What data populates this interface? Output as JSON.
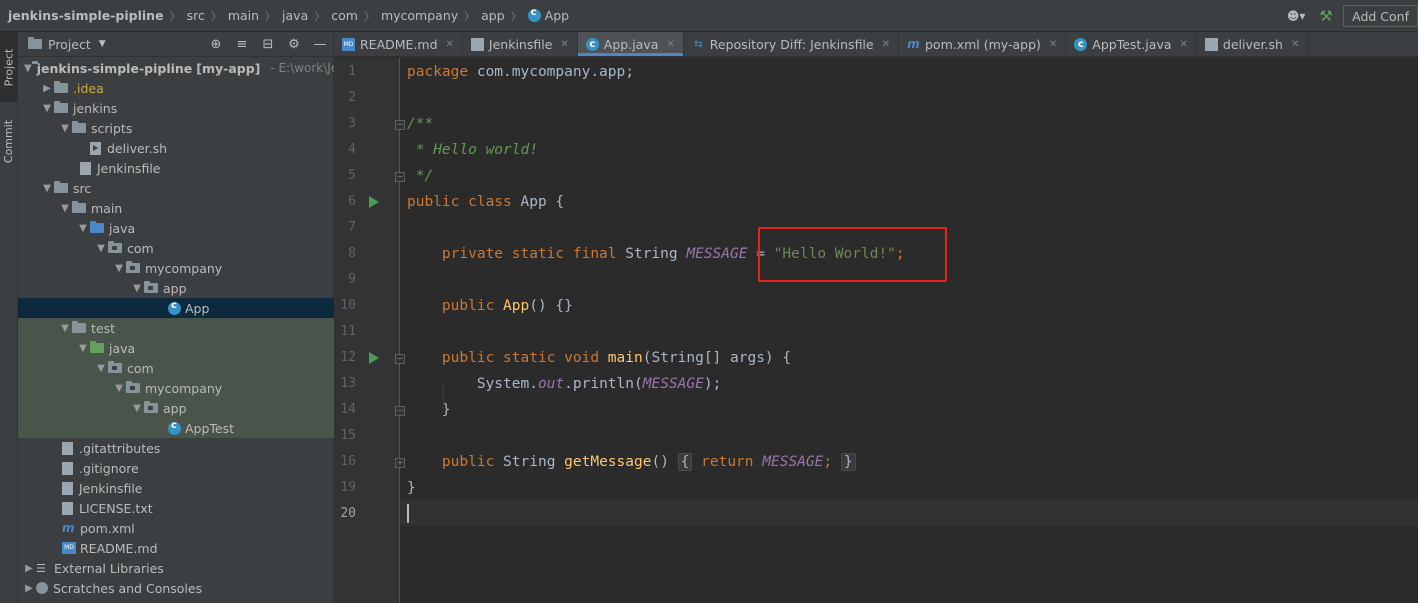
{
  "breadcrumbs": {
    "items": [
      "jenkins-simple-pipline",
      "src",
      "main",
      "java",
      "com",
      "mycompany",
      "app",
      "App"
    ],
    "add_config_label": "Add Conf"
  },
  "tool_stripe": {
    "project": "Project",
    "commit": "Commit"
  },
  "project_panel": {
    "title": "Project",
    "tree": {
      "root": {
        "label": "jenkins-simple-pipline",
        "module": "[my-app]",
        "path": "- E:\\work\\Jen"
      },
      "idea": ".idea",
      "jenkins": "jenkins",
      "scripts": "scripts",
      "deliver_sh": "deliver.sh",
      "jenkinsfile_inner": "Jenkinsfile",
      "src": "src",
      "main": "main",
      "main_java": "java",
      "main_com": "com",
      "main_mycompany": "mycompany",
      "main_app": "app",
      "App": "App",
      "test": "test",
      "test_java": "java",
      "test_com": "com",
      "test_mycompany": "mycompany",
      "test_app": "app",
      "AppTest": "AppTest",
      "gitattributes": ".gitattributes",
      "gitignore": ".gitignore",
      "jenkinsfile": "Jenkinsfile",
      "license": "LICENSE.txt",
      "pom": "pom.xml",
      "readme": "README.md",
      "external_libraries": "External Libraries",
      "scratches": "Scratches and Consoles"
    }
  },
  "tabs": [
    {
      "label": "README.md",
      "icon": "markdown-icon"
    },
    {
      "label": "Jenkinsfile",
      "icon": "file-icon"
    },
    {
      "label": "App.java",
      "icon": "java-class-icon",
      "active": true
    },
    {
      "label": "Repository Diff: Jenkinsfile",
      "icon": "diff-icon"
    },
    {
      "label": "pom.xml (my-app)",
      "icon": "maven-icon"
    },
    {
      "label": "AppTest.java",
      "icon": "java-class-icon"
    },
    {
      "label": "deliver.sh",
      "icon": "shell-file-icon"
    }
  ],
  "editor": {
    "line_numbers": [
      "1",
      "2",
      "3",
      "4",
      "5",
      "6",
      "7",
      "8",
      "9",
      "10",
      "11",
      "12",
      "13",
      "14",
      "15",
      "16",
      "19",
      "20"
    ],
    "current_line": "20",
    "code": {
      "l1_kw": "package",
      "l1_rest": " com.mycompany.app;",
      "l3": "/**",
      "l4": " * Hello world!",
      "l5": " */",
      "l6_kw": "public class",
      "l6_rest": " App {",
      "l8_kw": "    private static final",
      "l8_type": " String ",
      "l8_const": "MESSAGE",
      "l8_eq": " = ",
      "l8_str": "\"Hello World!\"",
      "l8_semi": ";",
      "l10_kw": "    public",
      "l10_fn": " App",
      "l10_rest": "() {}",
      "l12_kw": "    public static void",
      "l12_fn": " main",
      "l12_rest": "(String[] args) {",
      "l13_a": "        System.",
      "l13_out": "out",
      "l13_b": ".println(",
      "l13_const": "MESSAGE",
      "l13_c": ");",
      "l14": "    }",
      "l16_kw": "    public",
      "l16_type": " String ",
      "l16_fn": "getMessage",
      "l16_paren": "()",
      "l16_ob": "{",
      "l16_ret": " return ",
      "l16_const": "MESSAGE",
      "l16_semi": ";",
      "l16_cb": "}",
      "l19": "}"
    }
  },
  "colors": {
    "keyword": "#cc7832",
    "string": "#6a8759",
    "comment": "#629755",
    "constant": "#9876aa",
    "function": "#ffc66d",
    "highlight_box": "#e8231c",
    "selection": "#0d293e",
    "test_folder_bg": "#49544a"
  }
}
